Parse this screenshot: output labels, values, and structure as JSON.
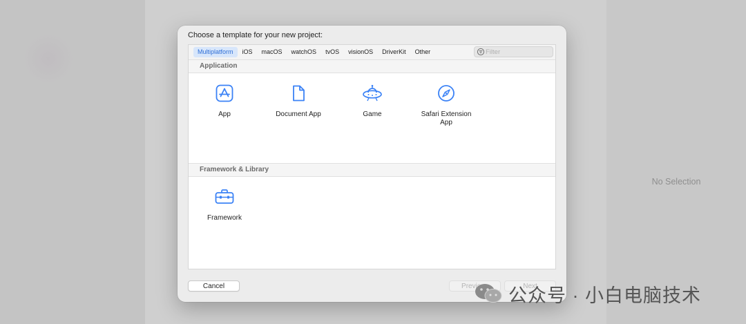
{
  "sheet": {
    "title": "Choose a template for your new project:"
  },
  "tabs": [
    {
      "label": "Multiplatform",
      "active": true
    },
    {
      "label": "iOS",
      "active": false
    },
    {
      "label": "macOS",
      "active": false
    },
    {
      "label": "watchOS",
      "active": false
    },
    {
      "label": "tvOS",
      "active": false
    },
    {
      "label": "visionOS",
      "active": false
    },
    {
      "label": "DriverKit",
      "active": false
    },
    {
      "label": "Other",
      "active": false
    }
  ],
  "filter": {
    "placeholder": "Filter",
    "value": ""
  },
  "sections": [
    {
      "label": "Application",
      "templates": [
        {
          "label": "App",
          "icon": "app-store-icon"
        },
        {
          "label": "Document App",
          "icon": "document-icon"
        },
        {
          "label": "Game",
          "icon": "game-icon"
        },
        {
          "label": "Safari Extension App",
          "label_line1": "Safari Extension",
          "label_line2": "App",
          "icon": "safari-compass-icon"
        }
      ]
    },
    {
      "label": "Framework & Library",
      "templates": [
        {
          "label": "Framework",
          "icon": "toolbox-icon"
        }
      ]
    }
  ],
  "buttons": {
    "cancel": "Cancel",
    "previous": "Previous",
    "next": "Next"
  },
  "inspector": {
    "empty_label": "No Selection"
  },
  "watermark": {
    "text": "公众号 · 小白电脑技术"
  },
  "colors": {
    "accent": "#3b82f6",
    "active_tab_bg": "#d7e6fb",
    "active_tab_text": "#2f6fd6"
  }
}
